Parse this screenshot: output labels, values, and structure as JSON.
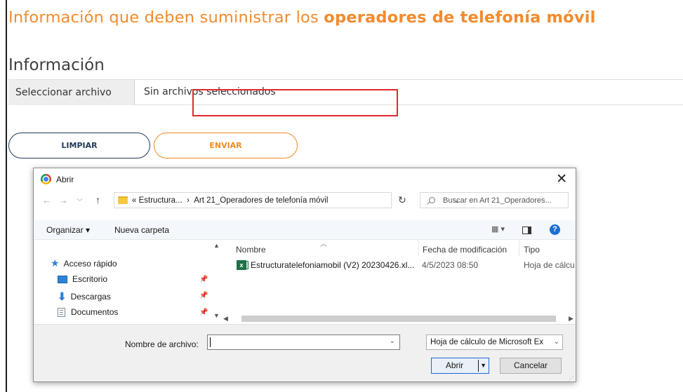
{
  "page": {
    "title_regular": "Información que deben suministrar los ",
    "title_bold": "operadores de telefonía móvil",
    "section_title": "Información",
    "file_button": "Seleccionar archivo",
    "file_status": "Sin archivos seleccionados",
    "clear_button": "LIMPIAR",
    "send_button": "ENVIAR"
  },
  "dialog": {
    "title": "Abrir",
    "close": "✕",
    "address": {
      "prefix": "«",
      "crumb1": "Estructura...",
      "sep": "›",
      "crumb2": "Art 21_Operadores de telefonía móvil"
    },
    "search_placeholder": "Buscar en Art 21_Operadores...",
    "toolbar": {
      "organize": "Organizar ▾",
      "new_folder": "Nueva carpeta"
    },
    "nav": {
      "quick_access": "Acceso rápido",
      "items": [
        "Escritorio",
        "Descargas",
        "Documentos"
      ]
    },
    "columns": {
      "name": "Nombre",
      "modified": "Fecha de modificación",
      "type": "Tipo"
    },
    "files": [
      {
        "name": "Estructuratelefoniamobil (V2) 20230426.xl...",
        "modified": "4/5/2023 08:50",
        "type": "Hoja de cálcu"
      }
    ],
    "filename_label": "Nombre de archivo:",
    "filename_value": "",
    "filetype": "Hoja de cálculo de Microsoft Ex",
    "open_button": "Abrir",
    "cancel_button": "Cancelar"
  },
  "colors": {
    "accent_orange": "#f28b2d",
    "navy": "#1f3b5a",
    "highlight_red": "#e0282e",
    "excel_green": "#1e7145"
  }
}
